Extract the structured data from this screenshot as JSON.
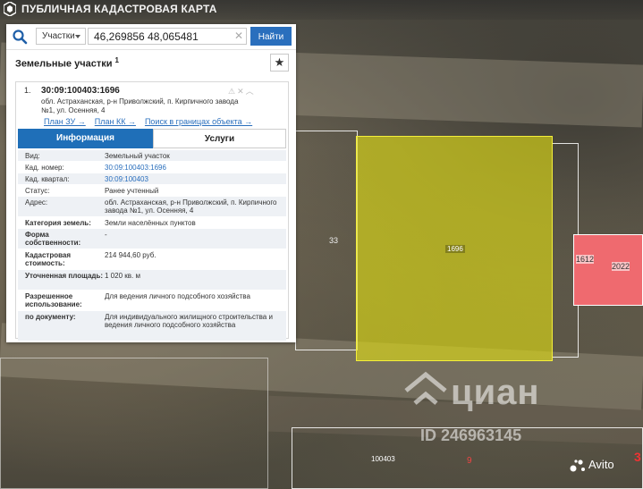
{
  "app": {
    "title": "ПУБЛИЧНАЯ КАДАСТРОВАЯ КАРТА"
  },
  "search": {
    "type_selected": "Участки",
    "query": "46,269856 48,065481",
    "find_label": "Найти"
  },
  "section": {
    "title": "Земельные участки",
    "count": "1"
  },
  "result": {
    "index": "1.",
    "cad_number": "30:09:100403:1696",
    "address": "обл. Астраханская, р-н Приволжский, п. Кирпичного завода №1, ул. Осенняя, 4",
    "links": [
      "План ЗУ →",
      "План КК →",
      "Поиск в границах объекта →"
    ],
    "tabs": [
      "Информация",
      "Услуги"
    ],
    "rows": [
      {
        "k": "Вид:",
        "v": "Земельный участок",
        "bold": false,
        "link": false
      },
      {
        "k": "Кад. номер:",
        "v": "30:09:100403:1696",
        "bold": false,
        "link": true
      },
      {
        "k": "Кад. квартал:",
        "v": "30:09:100403",
        "bold": false,
        "link": true
      },
      {
        "k": "Статус:",
        "v": "Ранее учтенный",
        "bold": false,
        "link": false
      },
      {
        "k": "Адрес:",
        "v": "обл. Астраханская, р-н Приволжский, п. Кирпичного завода №1, ул. Осенняя, 4",
        "bold": false,
        "link": false
      },
      {
        "k": "Категория земель:",
        "v": "Земли населённых пунктов",
        "bold": true,
        "link": false
      },
      {
        "k": "Форма собственности:",
        "v": "-",
        "bold": true,
        "link": false
      },
      {
        "k": "Кадастровая стоимость:",
        "v": "214 944,60 руб.",
        "bold": true,
        "link": false
      },
      {
        "k": "Уточненная площадь:",
        "v": "1 020 кв. м",
        "bold": true,
        "link": false
      },
      {
        "k": "Разрешенное использование:",
        "v": "Для ведения личного подсобного хозяйства",
        "bold": true,
        "link": false
      },
      {
        "k": "по документу:",
        "v": "Для индивидуального жилищного строительства и ведения личного подсобного хозяйства",
        "bold": true,
        "link": false
      }
    ]
  },
  "map": {
    "parcel_label": "1696",
    "label_33": "33",
    "label_1612": "1612",
    "label_2022": "2022",
    "label_bottom": "100403",
    "label_9": "9",
    "highlight_color": "#e2de14",
    "neighbor_color": "#ef6a6f"
  },
  "watermark": {
    "brand": "циан",
    "id": "ID 246963145"
  },
  "avito": {
    "label": "Avito",
    "red_mark": "3"
  }
}
